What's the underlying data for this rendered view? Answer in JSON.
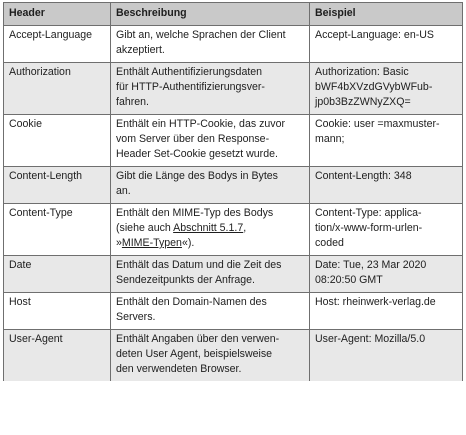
{
  "table": {
    "headers": [
      "Header",
      "Beschreibung",
      "Beispiel"
    ],
    "rows": [
      {
        "header": "Accept-Language",
        "description": [
          "Gibt an, welche Sprachen der Client",
          "akzeptiert."
        ],
        "example": [
          "Accept-Language: en-US"
        ]
      },
      {
        "header": "Authorization",
        "description": [
          "Enthält Authentifizierungsdaten",
          "für HTTP-Authentifizierungsver-",
          "fahren."
        ],
        "example": [
          "Authorization: Basic",
          "bWF4bXVzdGVybWFub-",
          "jp0b3BzZWNyZXQ="
        ]
      },
      {
        "header": "Cookie",
        "description": [
          "Enthält ein HTTP-Cookie, das zuvor",
          "vom Server über den Response-",
          "Header Set-Cookie gesetzt wurde."
        ],
        "example": [
          "Cookie: user =maxmuster-",
          "mann;"
        ]
      },
      {
        "header": "Content-Length",
        "description": [
          "Gibt die Länge des Bodys in Bytes",
          "an."
        ],
        "example": [
          "Content-Length: 348"
        ]
      },
      {
        "header": "Content-Type",
        "description_parts": {
          "line1": "Enthält den MIME-Typ des Bodys",
          "line2_prefix": "(siehe auch ",
          "line2_link": "Abschnitt 5.1.7",
          "line2_suffix": ",",
          "line3_prefix": "»",
          "line3_link": "MIME-Typen",
          "line3_suffix": "«)."
        },
        "example": [
          "Content-Type: applica-",
          "tion/x-www-form-urlen-",
          "coded"
        ]
      },
      {
        "header": "Date",
        "description": [
          "Enthält das Datum und die Zeit des",
          "Sendezeitpunkts der Anfrage."
        ],
        "example": [
          "Date: Tue, 23 Mar 2020",
          "08:20:50 GMT"
        ]
      },
      {
        "header": "Host",
        "description": [
          "Enthält den Domain-Namen des",
          "Servers."
        ],
        "example": [
          "Host: rheinwerk-verlag.de"
        ]
      },
      {
        "header": "User-Agent",
        "description": [
          "Enthält Angaben über den verwen-",
          "deten User Agent, beispielsweise",
          "den verwendeten Browser."
        ],
        "example": [
          "User-Agent: Mozilla/5.0"
        ]
      }
    ]
  }
}
